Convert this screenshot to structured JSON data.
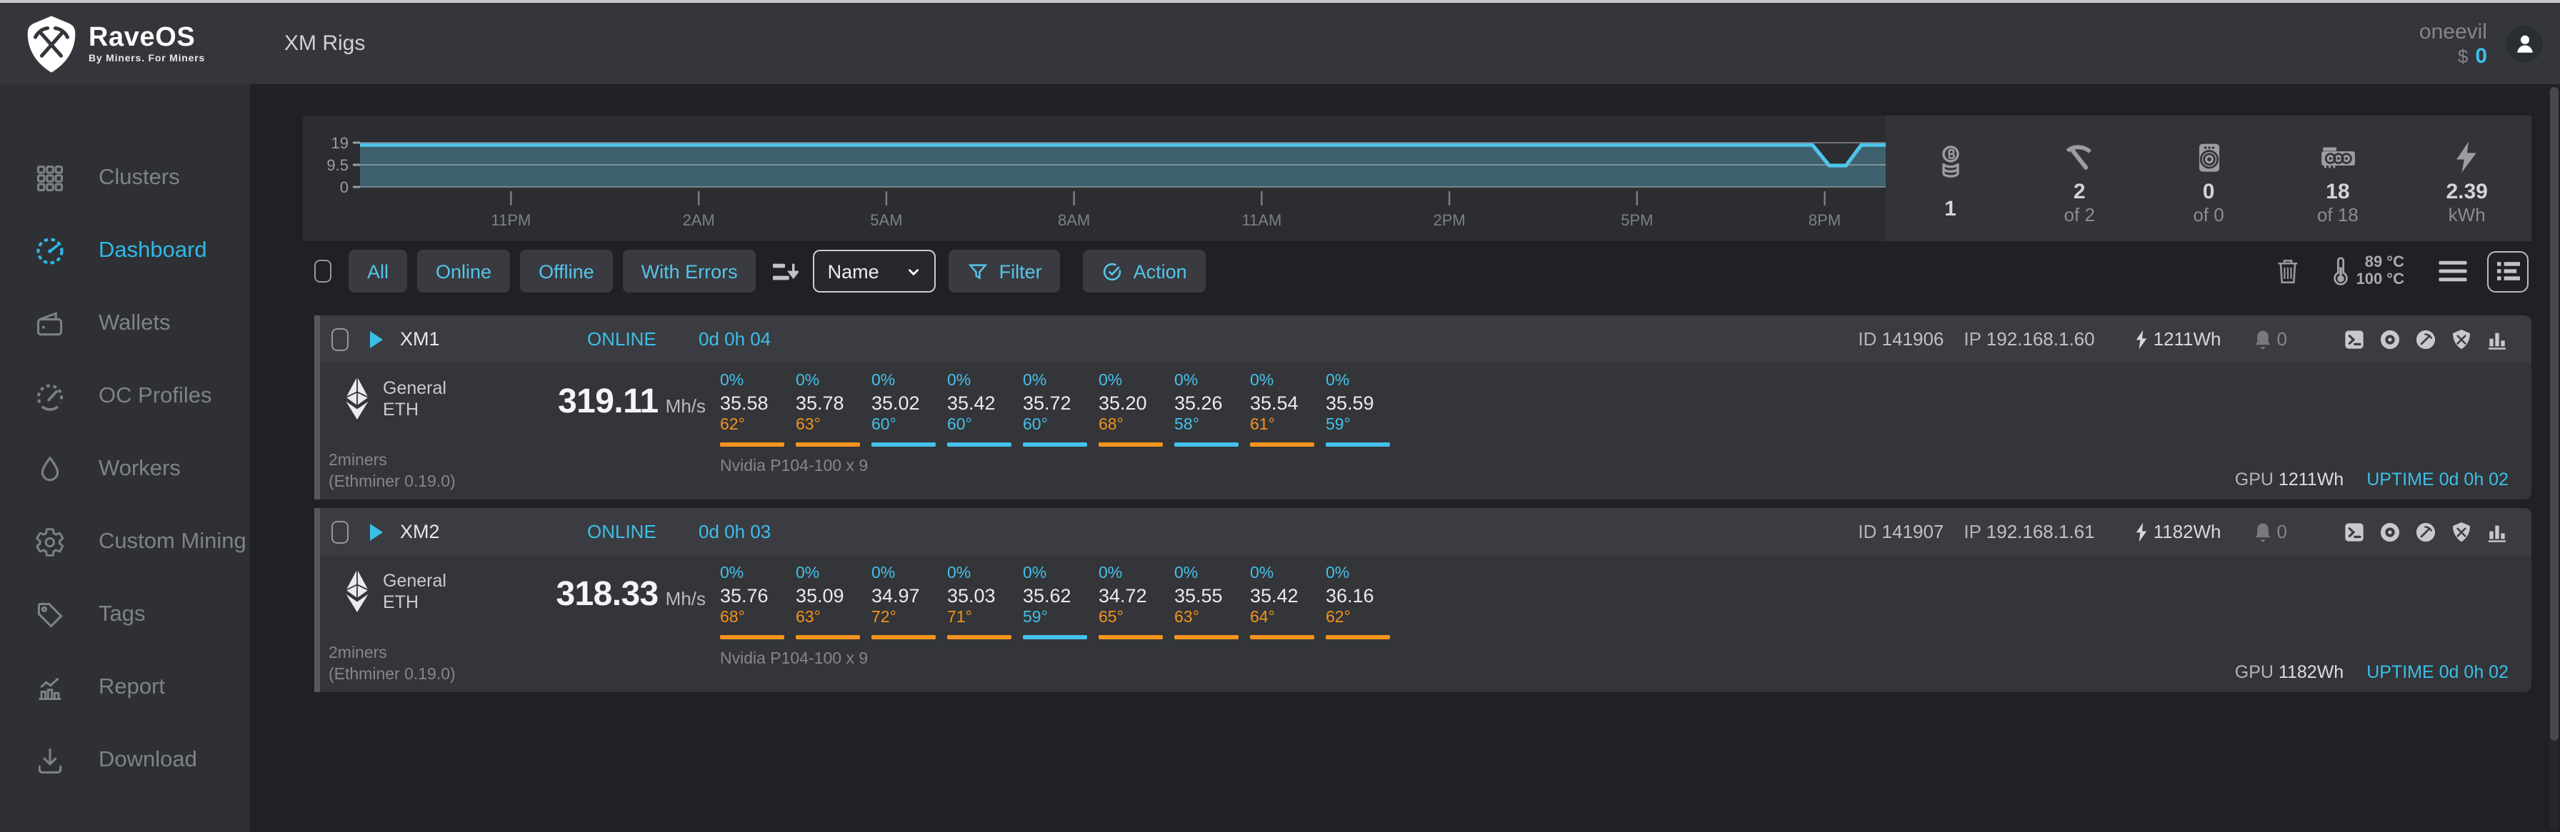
{
  "header": {
    "app_name": "RaveOS",
    "app_tagline": "By Miners. For Miners",
    "page_title": "XM Rigs",
    "username": "oneevil",
    "balance_prefix": "$",
    "balance_value": "0"
  },
  "sidebar": {
    "items": [
      {
        "label": "Clusters",
        "icon": "clusters-grid",
        "active": false
      },
      {
        "label": "Dashboard",
        "icon": "dashboard-gauge",
        "active": true
      },
      {
        "label": "Wallets",
        "icon": "wallet",
        "active": false
      },
      {
        "label": "OC Profiles",
        "icon": "oc-gauge",
        "active": false
      },
      {
        "label": "Workers",
        "icon": "droplet",
        "active": false
      },
      {
        "label": "Custom Mining",
        "icon": "gear",
        "active": false
      },
      {
        "label": "Tags",
        "icon": "tag",
        "active": false
      },
      {
        "label": "Report",
        "icon": "report-chart",
        "active": false
      },
      {
        "label": "Download",
        "icon": "download",
        "active": false
      }
    ]
  },
  "overview": {
    "chart_data": {
      "type": "area",
      "title": "",
      "xlabel": "",
      "ylabel": "",
      "ylim": [
        0,
        19
      ],
      "grid": true,
      "legend": false,
      "y_ticks": [
        19,
        9.5,
        0
      ],
      "x_ticks": [
        {
          "label": "11PM",
          "pos": 0.099
        },
        {
          "label": "2AM",
          "pos": 0.222
        },
        {
          "label": "5AM",
          "pos": 0.345
        },
        {
          "label": "8AM",
          "pos": 0.468
        },
        {
          "label": "11AM",
          "pos": 0.591
        },
        {
          "label": "2PM",
          "pos": 0.714
        },
        {
          "label": "5PM",
          "pos": 0.837
        },
        {
          "label": "8PM",
          "pos": 0.96
        }
      ],
      "series": [
        {
          "name": "value",
          "points": [
            [
              0,
              18
            ],
            [
              0.952,
              18
            ],
            [
              0.963,
              9.2
            ],
            [
              0.974,
              9.2
            ],
            [
              0.984,
              18
            ],
            [
              1,
              18
            ]
          ]
        }
      ],
      "fill_color": "#3f616d",
      "line_color": "#4ec5ea"
    },
    "stats": [
      {
        "icon": "coins",
        "value": "1",
        "sub": ""
      },
      {
        "icon": "pickaxe",
        "value": "2",
        "sub": "of 2"
      },
      {
        "icon": "asic",
        "value": "0",
        "sub": "of 0"
      },
      {
        "icon": "gpu",
        "value": "18",
        "sub": "of 18"
      },
      {
        "icon": "energy",
        "value": "2.39",
        "sub": "kWh"
      }
    ]
  },
  "toolbar": {
    "filter_tabs": [
      "All",
      "Online",
      "Offline",
      "With Errors"
    ],
    "sort_select_value": "Name",
    "filter_button": "Filter",
    "action_button": "Action",
    "temps": {
      "low": "89 °C",
      "high": "100 °C"
    },
    "icon_names": [
      "sort",
      "funnel",
      "check-circle",
      "trash",
      "thermometer",
      "menu",
      "list-view"
    ]
  },
  "rig_action_icons": [
    "console",
    "eye",
    "pickaxe-circle",
    "shield",
    "stats-bars"
  ],
  "rigs": [
    {
      "name": "XM1",
      "status": "ONLINE",
      "status_uptime": "0d 0h 04",
      "id_label": "ID",
      "id_value": "141906",
      "ip_label": "IP",
      "ip_value": "192.168.1.60",
      "power": "1211Wh",
      "notifications": "0",
      "coin_group": "General",
      "coin": "ETH",
      "hashrate": "319.11",
      "hashrate_unit": "Mh/s",
      "pool": "2miners",
      "miner_version": "(Ethminer 0.19.0)",
      "gpu_model": "Nvidia P104-100 x 9",
      "gpu_label": "GPU",
      "gpu_power": "1211Wh",
      "uptime_label": "UPTIME",
      "uptime_value": "0d 0h 02",
      "gpus": [
        {
          "load": "0%",
          "hashrate": "35.58",
          "temp": "62°",
          "temp_level": "hot"
        },
        {
          "load": "0%",
          "hashrate": "35.78",
          "temp": "63°",
          "temp_level": "hot"
        },
        {
          "load": "0%",
          "hashrate": "35.02",
          "temp": "60°",
          "temp_level": "normal"
        },
        {
          "load": "0%",
          "hashrate": "35.42",
          "temp": "60°",
          "temp_level": "normal"
        },
        {
          "load": "0%",
          "hashrate": "35.72",
          "temp": "60°",
          "temp_level": "normal"
        },
        {
          "load": "0%",
          "hashrate": "35.20",
          "temp": "68°",
          "temp_level": "hot"
        },
        {
          "load": "0%",
          "hashrate": "35.26",
          "temp": "58°",
          "temp_level": "normal"
        },
        {
          "load": "0%",
          "hashrate": "35.54",
          "temp": "61°",
          "temp_level": "hot"
        },
        {
          "load": "0%",
          "hashrate": "35.59",
          "temp": "59°",
          "temp_level": "normal"
        }
      ]
    },
    {
      "name": "XM2",
      "status": "ONLINE",
      "status_uptime": "0d 0h 03",
      "id_label": "ID",
      "id_value": "141907",
      "ip_label": "IP",
      "ip_value": "192.168.1.61",
      "power": "1182Wh",
      "notifications": "0",
      "coin_group": "General",
      "coin": "ETH",
      "hashrate": "318.33",
      "hashrate_unit": "Mh/s",
      "pool": "2miners",
      "miner_version": "(Ethminer 0.19.0)",
      "gpu_model": "Nvidia P104-100 x 9",
      "gpu_label": "GPU",
      "gpu_power": "1182Wh",
      "uptime_label": "UPTIME",
      "uptime_value": "0d 0h 02",
      "gpus": [
        {
          "load": "0%",
          "hashrate": "35.76",
          "temp": "68°",
          "temp_level": "hot"
        },
        {
          "load": "0%",
          "hashrate": "35.09",
          "temp": "63°",
          "temp_level": "hot"
        },
        {
          "load": "0%",
          "hashrate": "34.97",
          "temp": "72°",
          "temp_level": "hot"
        },
        {
          "load": "0%",
          "hashrate": "35.03",
          "temp": "71°",
          "temp_level": "hot"
        },
        {
          "load": "0%",
          "hashrate": "35.62",
          "temp": "59°",
          "temp_level": "normal"
        },
        {
          "load": "0%",
          "hashrate": "34.72",
          "temp": "65°",
          "temp_level": "hot"
        },
        {
          "load": "0%",
          "hashrate": "35.55",
          "temp": "63°",
          "temp_level": "hot"
        },
        {
          "load": "0%",
          "hashrate": "35.42",
          "temp": "64°",
          "temp_level": "hot"
        },
        {
          "load": "0%",
          "hashrate": "36.16",
          "temp": "62°",
          "temp_level": "hot"
        }
      ]
    }
  ],
  "colors": {
    "accent": "#45c1ea",
    "temp_hot": "#f5931d",
    "temp_normal": "#45c1ea",
    "online": "#3bbfe9"
  }
}
